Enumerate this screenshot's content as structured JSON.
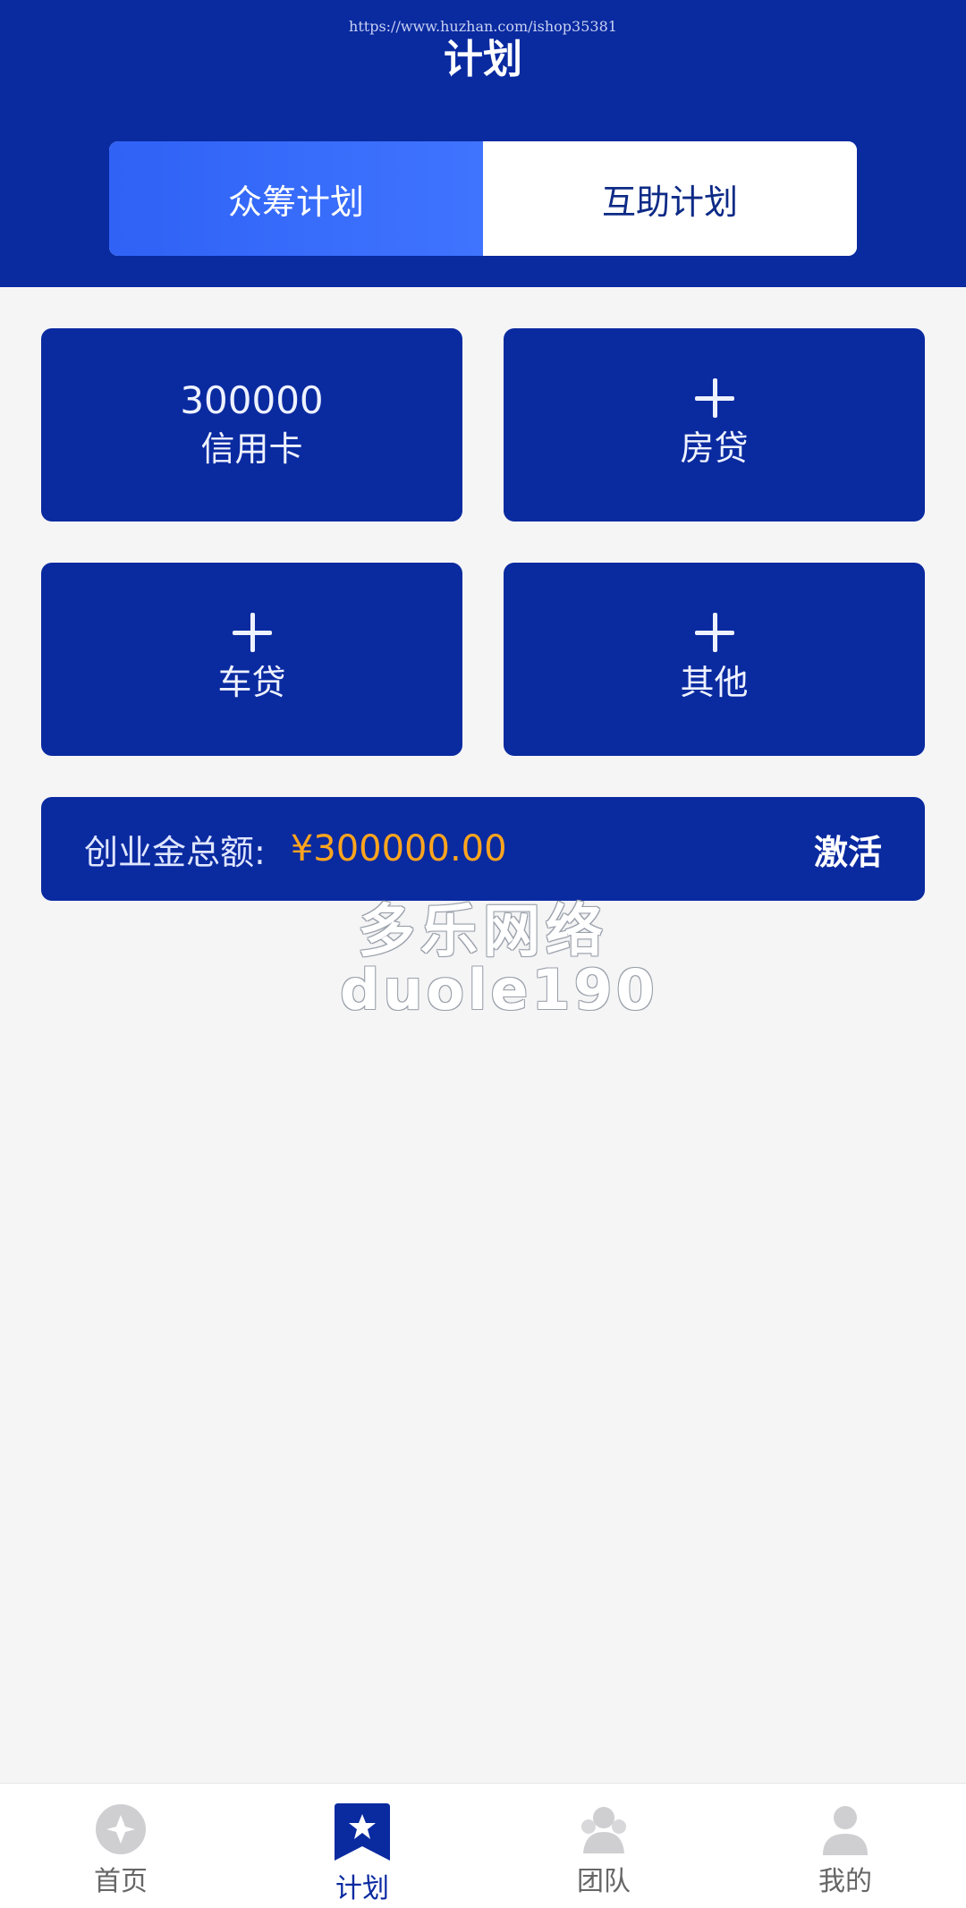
{
  "watermark_url": "https://www.huzhan.com/ishop35381",
  "page_title": "计划",
  "tabs": [
    {
      "label": "众筹计划",
      "active": true
    },
    {
      "label": "互助计划",
      "active": false
    }
  ],
  "cards": [
    {
      "amount": "300000",
      "label": "信用卡"
    },
    {
      "label": "房贷",
      "icon": "plus-icon"
    },
    {
      "label": "车贷",
      "icon": "plus-icon"
    },
    {
      "label": "其他",
      "icon": "plus-icon"
    }
  ],
  "fund": {
    "label": "创业金总额:",
    "amount": "¥300000.00",
    "action": "激活"
  },
  "watermark": {
    "title": "多乐网络",
    "subtitle": "duole190"
  },
  "bottom_nav": [
    {
      "label": "首页",
      "icon": "home-diamond-icon",
      "active": false
    },
    {
      "label": "计划",
      "icon": "star-bookmark-icon",
      "active": true
    },
    {
      "label": "团队",
      "icon": "team-icon",
      "active": false
    },
    {
      "label": "我的",
      "icon": "user-icon",
      "active": false
    }
  ],
  "colors": {
    "primary": "#0a2aa0",
    "tab_active": "#3f74ff",
    "amount": "#ffa51e",
    "background": "#f5f5f6"
  }
}
